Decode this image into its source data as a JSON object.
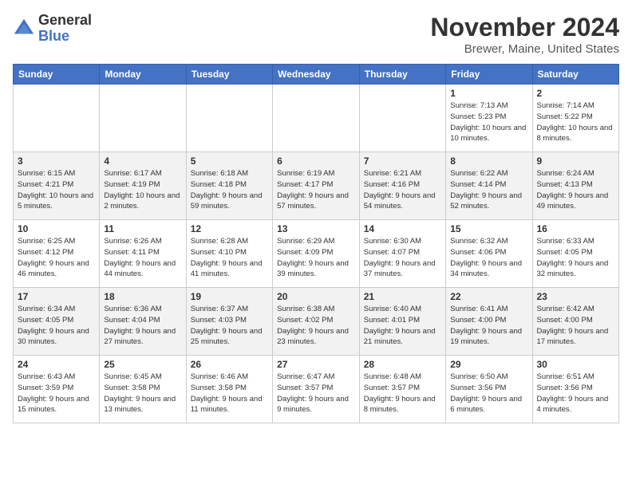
{
  "header": {
    "logo": {
      "general": "General",
      "blue": "Blue"
    },
    "title": "November 2024",
    "location": "Brewer, Maine, United States"
  },
  "calendar": {
    "weekdays": [
      "Sunday",
      "Monday",
      "Tuesday",
      "Wednesday",
      "Thursday",
      "Friday",
      "Saturday"
    ],
    "weeks": [
      [
        {
          "day": "",
          "info": ""
        },
        {
          "day": "",
          "info": ""
        },
        {
          "day": "",
          "info": ""
        },
        {
          "day": "",
          "info": ""
        },
        {
          "day": "",
          "info": ""
        },
        {
          "day": "1",
          "info": "Sunrise: 7:13 AM\nSunset: 5:23 PM\nDaylight: 10 hours and 10 minutes."
        },
        {
          "day": "2",
          "info": "Sunrise: 7:14 AM\nSunset: 5:22 PM\nDaylight: 10 hours and 8 minutes."
        }
      ],
      [
        {
          "day": "3",
          "info": "Sunrise: 6:15 AM\nSunset: 4:21 PM\nDaylight: 10 hours and 5 minutes."
        },
        {
          "day": "4",
          "info": "Sunrise: 6:17 AM\nSunset: 4:19 PM\nDaylight: 10 hours and 2 minutes."
        },
        {
          "day": "5",
          "info": "Sunrise: 6:18 AM\nSunset: 4:18 PM\nDaylight: 9 hours and 59 minutes."
        },
        {
          "day": "6",
          "info": "Sunrise: 6:19 AM\nSunset: 4:17 PM\nDaylight: 9 hours and 57 minutes."
        },
        {
          "day": "7",
          "info": "Sunrise: 6:21 AM\nSunset: 4:16 PM\nDaylight: 9 hours and 54 minutes."
        },
        {
          "day": "8",
          "info": "Sunrise: 6:22 AM\nSunset: 4:14 PM\nDaylight: 9 hours and 52 minutes."
        },
        {
          "day": "9",
          "info": "Sunrise: 6:24 AM\nSunset: 4:13 PM\nDaylight: 9 hours and 49 minutes."
        }
      ],
      [
        {
          "day": "10",
          "info": "Sunrise: 6:25 AM\nSunset: 4:12 PM\nDaylight: 9 hours and 46 minutes."
        },
        {
          "day": "11",
          "info": "Sunrise: 6:26 AM\nSunset: 4:11 PM\nDaylight: 9 hours and 44 minutes."
        },
        {
          "day": "12",
          "info": "Sunrise: 6:28 AM\nSunset: 4:10 PM\nDaylight: 9 hours and 41 minutes."
        },
        {
          "day": "13",
          "info": "Sunrise: 6:29 AM\nSunset: 4:09 PM\nDaylight: 9 hours and 39 minutes."
        },
        {
          "day": "14",
          "info": "Sunrise: 6:30 AM\nSunset: 4:07 PM\nDaylight: 9 hours and 37 minutes."
        },
        {
          "day": "15",
          "info": "Sunrise: 6:32 AM\nSunset: 4:06 PM\nDaylight: 9 hours and 34 minutes."
        },
        {
          "day": "16",
          "info": "Sunrise: 6:33 AM\nSunset: 4:05 PM\nDaylight: 9 hours and 32 minutes."
        }
      ],
      [
        {
          "day": "17",
          "info": "Sunrise: 6:34 AM\nSunset: 4:05 PM\nDaylight: 9 hours and 30 minutes."
        },
        {
          "day": "18",
          "info": "Sunrise: 6:36 AM\nSunset: 4:04 PM\nDaylight: 9 hours and 27 minutes."
        },
        {
          "day": "19",
          "info": "Sunrise: 6:37 AM\nSunset: 4:03 PM\nDaylight: 9 hours and 25 minutes."
        },
        {
          "day": "20",
          "info": "Sunrise: 6:38 AM\nSunset: 4:02 PM\nDaylight: 9 hours and 23 minutes."
        },
        {
          "day": "21",
          "info": "Sunrise: 6:40 AM\nSunset: 4:01 PM\nDaylight: 9 hours and 21 minutes."
        },
        {
          "day": "22",
          "info": "Sunrise: 6:41 AM\nSunset: 4:00 PM\nDaylight: 9 hours and 19 minutes."
        },
        {
          "day": "23",
          "info": "Sunrise: 6:42 AM\nSunset: 4:00 PM\nDaylight: 9 hours and 17 minutes."
        }
      ],
      [
        {
          "day": "24",
          "info": "Sunrise: 6:43 AM\nSunset: 3:59 PM\nDaylight: 9 hours and 15 minutes."
        },
        {
          "day": "25",
          "info": "Sunrise: 6:45 AM\nSunset: 3:58 PM\nDaylight: 9 hours and 13 minutes."
        },
        {
          "day": "26",
          "info": "Sunrise: 6:46 AM\nSunset: 3:58 PM\nDaylight: 9 hours and 11 minutes."
        },
        {
          "day": "27",
          "info": "Sunrise: 6:47 AM\nSunset: 3:57 PM\nDaylight: 9 hours and 9 minutes."
        },
        {
          "day": "28",
          "info": "Sunrise: 6:48 AM\nSunset: 3:57 PM\nDaylight: 9 hours and 8 minutes."
        },
        {
          "day": "29",
          "info": "Sunrise: 6:50 AM\nSunset: 3:56 PM\nDaylight: 9 hours and 6 minutes."
        },
        {
          "day": "30",
          "info": "Sunrise: 6:51 AM\nSunset: 3:56 PM\nDaylight: 9 hours and 4 minutes."
        }
      ]
    ]
  }
}
